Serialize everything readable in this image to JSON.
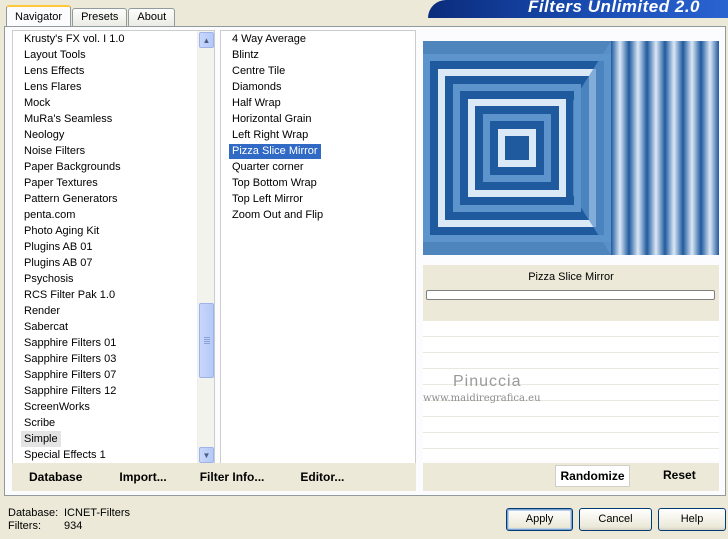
{
  "tabs": [
    "Navigator",
    "Presets",
    "About"
  ],
  "active_tab": "Navigator",
  "app_title": "Filters Unlimited 2.0",
  "categories": [
    "Krusty's FX vol. I 1.0",
    "Layout Tools",
    "Lens Effects",
    "Lens Flares",
    "Mock",
    "MuRa's Seamless",
    "Neology",
    "Noise Filters",
    "Paper Backgrounds",
    "Paper Textures",
    "Pattern Generators",
    "penta.com",
    "Photo Aging Kit",
    "Plugins AB 01",
    "Plugins AB 07",
    "Psychosis",
    "RCS Filter Pak 1.0",
    "Render",
    "Sabercat",
    "Sapphire Filters 01",
    "Sapphire Filters 03",
    "Sapphire Filters 07",
    "Sapphire Filters 12",
    "ScreenWorks",
    "Scribe",
    "Simple",
    "Special Effects 1"
  ],
  "selected_category": "Simple",
  "filters": [
    "4 Way Average",
    "Blintz",
    "Centre Tile",
    "Diamonds",
    "Half Wrap",
    "Horizontal Grain",
    "Left Right Wrap",
    "Pizza Slice Mirror",
    "Quarter corner",
    "Top Bottom Wrap",
    "Top Left Mirror",
    "Zoom Out and Flip"
  ],
  "selected_filter": "Pizza Slice Mirror",
  "preview": {
    "filter_name": "Pizza Slice Mirror",
    "watermark_name": "Pinuccia",
    "watermark_url": "www.maidiregrafica.eu",
    "colors": {
      "dark": "#1f5a9e",
      "light": "#dbe8f6",
      "mid": "#5d94cc"
    }
  },
  "left_buttons": {
    "database": "Database",
    "import": "Import...",
    "filter_info": "Filter Info...",
    "editor": "Editor..."
  },
  "right_buttons": {
    "randomize": "Randomize",
    "reset": "Reset"
  },
  "footer": {
    "database_label": "Database:",
    "database_value": "ICNET-Filters",
    "filters_label": "Filters:",
    "filters_value": "934"
  },
  "dialog_buttons": {
    "apply": "Apply",
    "cancel": "Cancel",
    "help": "Help"
  }
}
